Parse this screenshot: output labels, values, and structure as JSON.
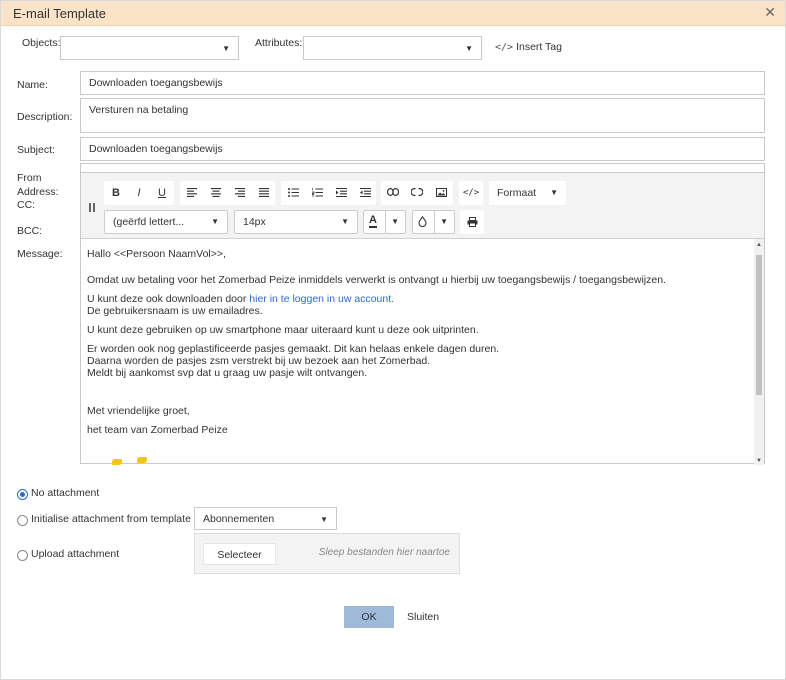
{
  "dialog": {
    "title": "E-mail Template"
  },
  "topbar": {
    "objects_label": "Objects:",
    "attributes_label": "Attributes:",
    "insert_tag": "Insert Tag"
  },
  "form": {
    "name_label": "Name:",
    "name_value": "Downloaden toegangsbewijs",
    "description_label": "Description:",
    "description_value": "Versturen na betaling",
    "subject_label": "Subject:",
    "subject_value": "Downloaden toegangsbewijs",
    "from_label": "From",
    "address_label": "Address:",
    "cc_label": "CC:",
    "bcc_label": "BCC:",
    "message_label": "Message:"
  },
  "toolbar": {
    "bold": "B",
    "italic": "I",
    "underline": "U",
    "format_select": "Formaat",
    "font_select": "(geërfd lettert...",
    "size_select": "14px",
    "font_color": "A"
  },
  "message": {
    "greeting": "Hallo <<Persoon NaamVol>>,",
    "p1": "Omdat uw betaling voor het Zomerbad Peize inmiddels verwerkt is ontvangt u hierbij uw toegangsbewijs / toegangsbewijzen.",
    "p2_pre": "U kunt deze ook downloaden door ",
    "p2_link": "hier in te loggen in uw account.",
    "p2_line2": "De gebruikersnaam is uw emailadres.",
    "p3": "U kunt deze gebruiken op uw smartphone maar uiteraard kunt u deze ook uitprinten.",
    "p4_line1": "Er worden ook nog geplastificeerde pasjes gemaakt. Dit kan helaas enkele dagen duren.",
    "p4_line2": "Daarna worden de pasjes  zsm verstrekt bij uw bezoek aan het Zomerbad.",
    "p4_line3": "Meldt bij aankomst svp dat u graag uw pasje wilt ontvangen.",
    "closing": "Met vriendelijke groet,",
    "signature": "het team van Zomerbad Peize"
  },
  "attachment": {
    "no_attachment": "No attachment",
    "from_template": "Initialise attachment from template",
    "template_select": "Abonnementen",
    "upload": "Upload attachment",
    "select_button": "Selecteer",
    "drop_hint": "Sleep bestanden hier naartoe"
  },
  "footer": {
    "ok": "OK",
    "close": "Sluiten"
  },
  "colors": {
    "titlebar": "#fbe3c8",
    "link": "#2a6ad6",
    "ok_button": "#9fb9d9"
  }
}
